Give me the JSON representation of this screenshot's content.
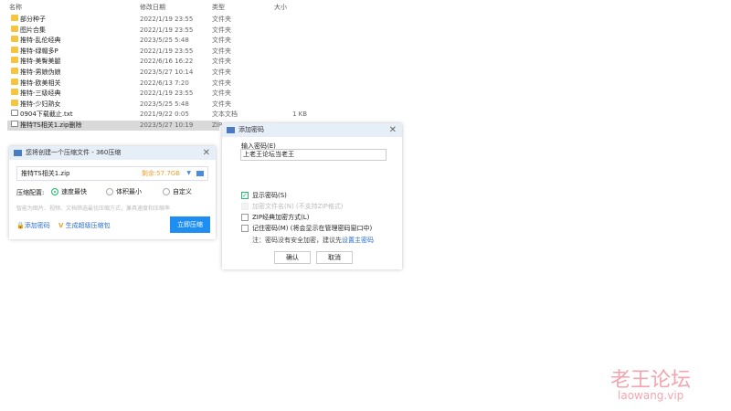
{
  "explorer": {
    "headers": {
      "name": "名称",
      "date": "修改日期",
      "type": "类型",
      "size": "大小"
    },
    "files": [
      {
        "name": "部分种子",
        "date": "2022/1/19 23:55",
        "type": "文件夹",
        "size": ""
      },
      {
        "name": "图片合集",
        "date": "2022/1/19 23:55",
        "type": "文件夹",
        "size": ""
      },
      {
        "name": "推特-乱伦经典",
        "date": "2023/5/25 5:48",
        "type": "文件夹",
        "size": ""
      },
      {
        "name": "推特-绿帽多P",
        "date": "2022/1/19 23:55",
        "type": "文件夹",
        "size": ""
      },
      {
        "name": "推特-美臀美腿",
        "date": "2022/6/16 16:22",
        "type": "文件夹",
        "size": ""
      },
      {
        "name": "推特-男娘伪娘",
        "date": "2023/5/27 10:14",
        "type": "文件夹",
        "size": ""
      },
      {
        "name": "推特-欧美相关",
        "date": "2022/6/13 7:20",
        "type": "文件夹",
        "size": ""
      },
      {
        "name": "推特-三级经典",
        "date": "2022/1/19 23:55",
        "type": "文件夹",
        "size": ""
      },
      {
        "name": "推特-少妇熟女",
        "date": "2023/5/25 5:48",
        "type": "文件夹",
        "size": ""
      },
      {
        "name": "0904下载截止.txt",
        "date": "2021/9/22 0:05",
        "type": "文本文档",
        "size": "1 KB"
      },
      {
        "name": "推特TS相关1.zip删除",
        "date": "2023/5/27 10:19",
        "type": "ZIP",
        "size": ""
      }
    ]
  },
  "compress": {
    "title": "您将创建一个压缩文件 - 360压缩",
    "filename": "推特TS相关1.zip",
    "free": "剩余:57.7GB",
    "config_label": "压缩配置:",
    "options": [
      "速度最快",
      "体积最小",
      "自定义"
    ],
    "hint": "智能为图片、视频、文档筛选最优压缩方式，兼具速度和压缩率",
    "add_password": "添加密码",
    "gen_package": "生成超级压缩包",
    "compress_now": "立即压缩"
  },
  "password": {
    "title": "添加密码",
    "input_label": "输入密码(E)",
    "value": "上老王论坛当老王",
    "show": "显示密码(S)",
    "encrypt_names": "加密文件名(N) (不支持ZIP格式)",
    "zip_classic": "ZIP经典加密方式(L)",
    "remember": "记住密码(M) (将会显示在管理密码窗口中)",
    "note": "注：密码没有安全加密，建议先",
    "note_link": "设置主密码",
    "ok": "确认",
    "cancel": "取消"
  },
  "watermark": {
    "cn": "老王论坛",
    "en": "laowang.vip"
  }
}
